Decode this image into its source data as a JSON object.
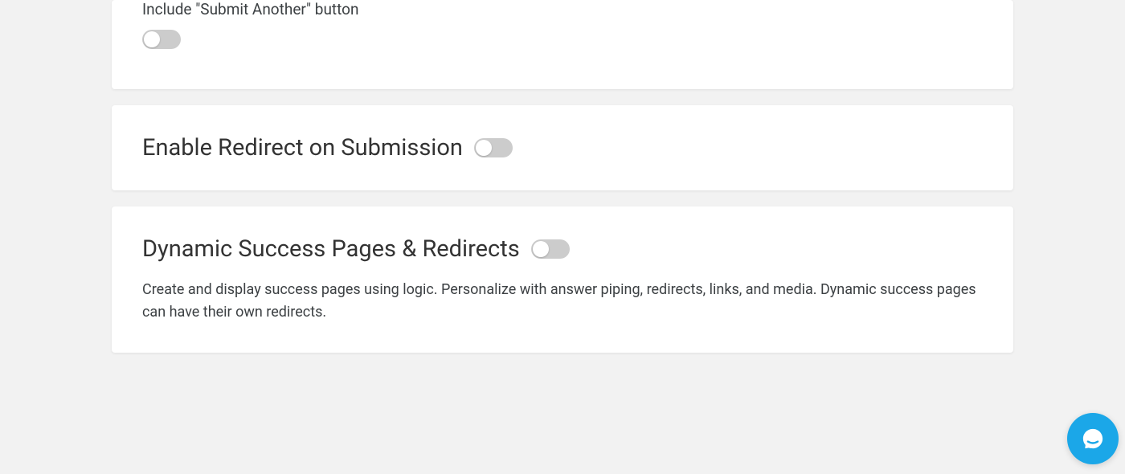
{
  "cards": {
    "submitAnother": {
      "label": "Include \"Submit Another\" button"
    },
    "redirect": {
      "title": "Enable Redirect on Submission"
    },
    "dynamic": {
      "title": "Dynamic Success Pages & Redirects",
      "description": "Create and display success pages using logic. Personalize with answer piping, redirects, links, and media. Dynamic success pages can have their own redirects."
    }
  }
}
